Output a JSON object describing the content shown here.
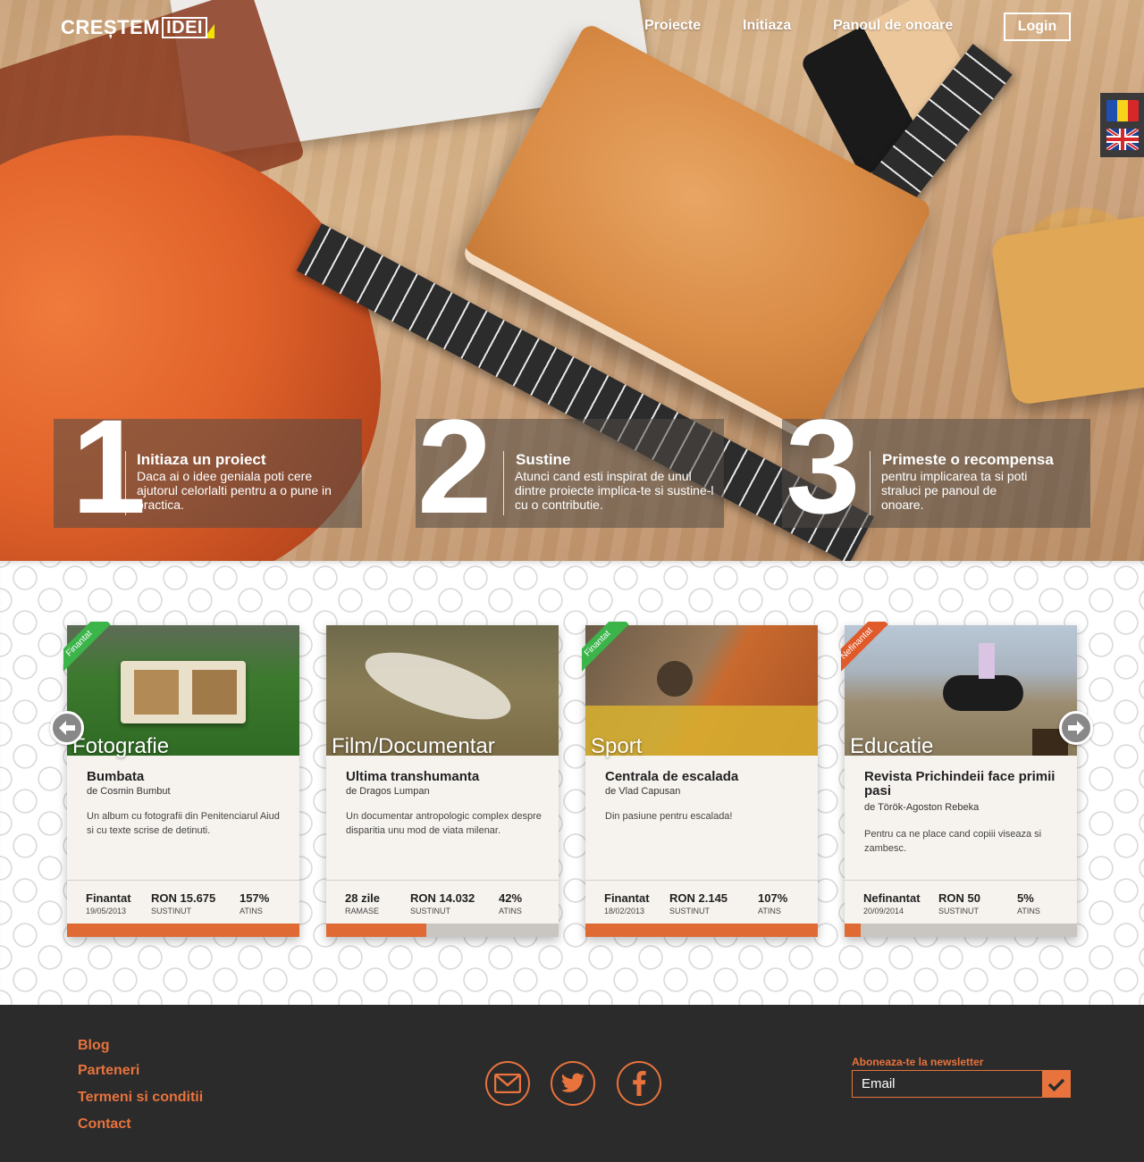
{
  "header": {
    "logo_word": "CREȘTEM",
    "logo_box": "IDEI",
    "nav": [
      {
        "label": "Proiecte"
      },
      {
        "label": "Initiaza"
      },
      {
        "label": "Panoul de onoare"
      }
    ],
    "login_label": "Login"
  },
  "languages": [
    {
      "icon": "romania-flag-icon"
    },
    {
      "icon": "uk-flag-icon"
    }
  ],
  "steps": [
    {
      "num": "1",
      "title": "Initiaza un proiect",
      "text": "Daca ai o idee geniala poti cere ajutorul celorlalti pentru a o pune in practica."
    },
    {
      "num": "2",
      "title": "Sustine",
      "text": "Atunci cand esti inspirat de unul dintre proiecte implica-te si sustine-l cu o contributie."
    },
    {
      "num": "3",
      "title": "Primeste o recompensa",
      "text": "pentru implicarea ta si poti straluci pe panoul de onoare."
    }
  ],
  "projects": [
    {
      "category": "Fotografie",
      "ribbon": "Finantat",
      "title": "Bumbata",
      "author": "de Cosmin Bumbut",
      "description": "Un album cu fotografii din Penitenciarul Aiud si cu texte scrise de detinuti.",
      "stat1_main": "Finantat",
      "stat1_sub": "19/05/2013",
      "stat2_main": "RON 15.675",
      "stat2_sub": "SUSTINUT",
      "stat3_main": "157%",
      "stat3_sub": "ATINS",
      "progress": 1.0
    },
    {
      "category": "Film/Documentar",
      "ribbon": "",
      "title": "Ultima transhumanta",
      "author": "de Dragos Lumpan",
      "description": "Un documentar antropologic complex despre disparitia unu mod de viata milenar.",
      "stat1_main": "28 zile",
      "stat1_sub": "RAMASE",
      "stat2_main": "RON 14.032",
      "stat2_sub": "SUSTINUT",
      "stat3_main": "42%",
      "stat3_sub": "ATINS",
      "progress": 0.43
    },
    {
      "category": "Sport",
      "ribbon": "Finantat",
      "title": "Centrala de escalada",
      "author": "de Vlad Capusan",
      "description": "Din pasiune pentru escalada!",
      "stat1_main": "Finantat",
      "stat1_sub": "18/02/2013",
      "stat2_main": "RON 2.145",
      "stat2_sub": "SUSTINUT",
      "stat3_main": "107%",
      "stat3_sub": "ATINS",
      "progress": 1.0
    },
    {
      "category": "Educatie",
      "ribbon": "Nefinantat",
      "title": "Revista Prichindeii face primii pasi",
      "author": "de Török-Agoston Rebeka",
      "description": "Pentru ca ne place cand copiii viseaza si zambesc.",
      "stat1_main": "Nefinantat",
      "stat1_sub": "20/09/2014",
      "stat2_main": "RON 50",
      "stat2_sub": "SUSTINUT",
      "stat3_main": "5%",
      "stat3_sub": "ATINS",
      "progress": 0.07
    }
  ],
  "footer": {
    "links": [
      "Blog",
      "Parteneri",
      "Termeni si conditii",
      "Contact"
    ],
    "social": [
      "email-icon",
      "twitter-icon",
      "facebook-icon"
    ],
    "newsletter_label": "Aboneaza-te la newsletter",
    "newsletter_placeholder": "Email"
  },
  "colors": {
    "accent": "#e8733d",
    "funded_ribbon": "#3bb44a",
    "unfunded_ribbon": "#e05a2a",
    "footer_bg": "#2b2b2b"
  }
}
